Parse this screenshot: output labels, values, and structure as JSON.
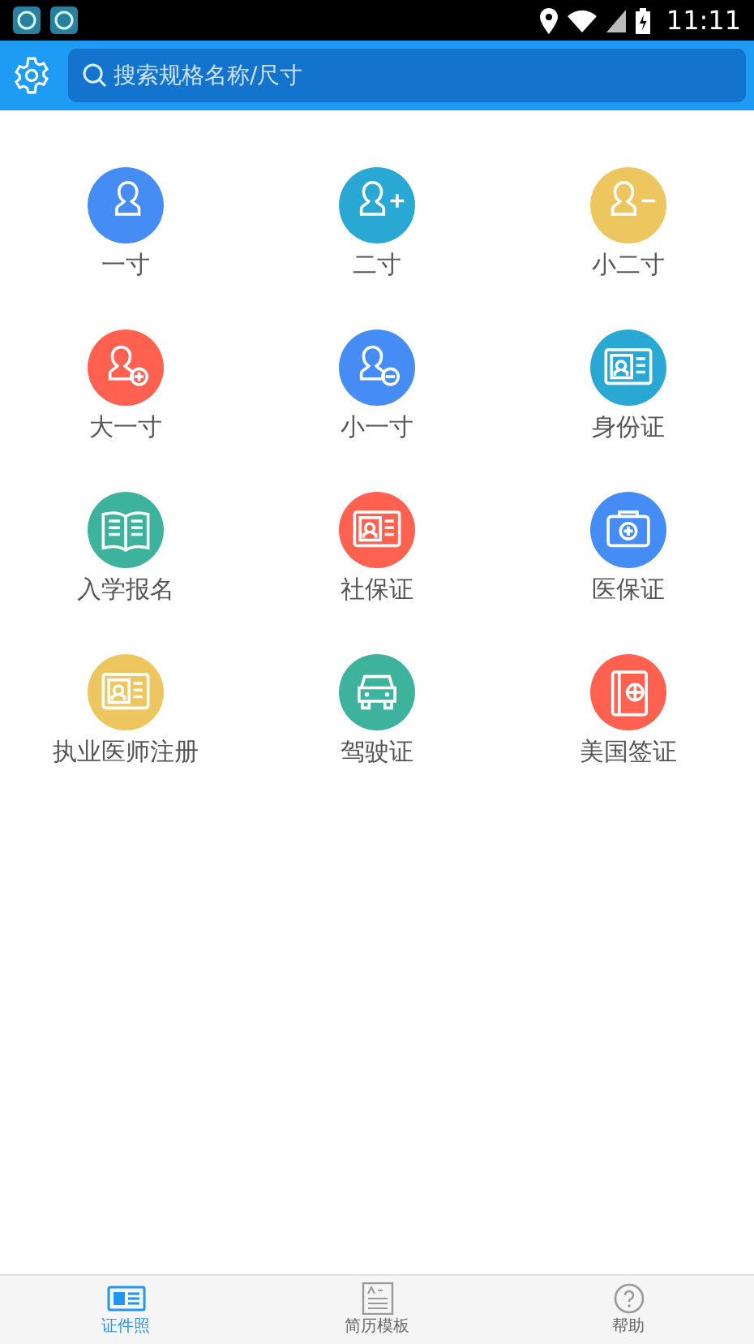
{
  "status_bar": {
    "time": "11:11"
  },
  "search": {
    "placeholder": "搜索规格名称/尺寸"
  },
  "items": [
    {
      "label": "一寸",
      "kind": "person",
      "color": "#458cf5"
    },
    {
      "label": "二寸",
      "kind": "person-plus",
      "color": "#29a8d3"
    },
    {
      "label": "小二寸",
      "kind": "person-minus",
      "color": "#eec660"
    },
    {
      "label": "大一寸",
      "kind": "person-plus-circle",
      "color": "#ff6150"
    },
    {
      "label": "小一寸",
      "kind": "person-minus-circle",
      "color": "#458cf5"
    },
    {
      "label": "身份证",
      "kind": "id-card",
      "color": "#29a8d3"
    },
    {
      "label": "入学报名",
      "kind": "book",
      "color": "#3db39e"
    },
    {
      "label": "社保证",
      "kind": "id-card",
      "color": "#ff6150"
    },
    {
      "label": "医保证",
      "kind": "medkit",
      "color": "#458cf5"
    },
    {
      "label": "执业医师注册",
      "kind": "id-card",
      "color": "#eec660"
    },
    {
      "label": "驾驶证",
      "kind": "car",
      "color": "#3db39e"
    },
    {
      "label": "美国签证",
      "kind": "passport",
      "color": "#ff6150"
    }
  ],
  "tabs": [
    {
      "label": "证件照",
      "kind": "id",
      "selected": true
    },
    {
      "label": "简历模板",
      "kind": "resume",
      "selected": false
    },
    {
      "label": "帮助",
      "kind": "help",
      "selected": false
    }
  ]
}
